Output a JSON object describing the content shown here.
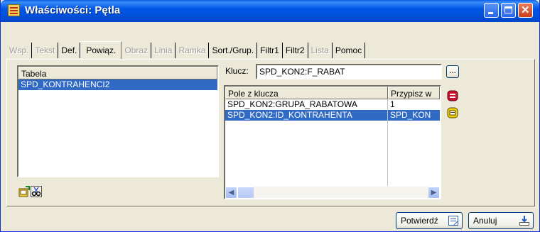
{
  "window": {
    "title": "Właściwości: Pętla"
  },
  "tabs": [
    {
      "label": "Wsp.",
      "enabled": false
    },
    {
      "label": "Tekst",
      "enabled": false
    },
    {
      "label": "Def.",
      "enabled": true
    },
    {
      "label": "Powiąz.",
      "enabled": true,
      "active": true
    },
    {
      "label": "Obraz",
      "enabled": false
    },
    {
      "label": "Linia",
      "enabled": false
    },
    {
      "label": "Ramka",
      "enabled": false
    },
    {
      "label": "Sort./Grup.",
      "enabled": true
    },
    {
      "label": "Filtr1",
      "enabled": true
    },
    {
      "label": "Filtr2",
      "enabled": true
    },
    {
      "label": "Lista",
      "enabled": false
    },
    {
      "label": "Pomoc",
      "enabled": true
    }
  ],
  "tables": {
    "header": "Tabela",
    "items": [
      "SPD_KONTRAHENCI2"
    ],
    "selected_index": 0
  },
  "key": {
    "label": "Klucz:",
    "value": "SPD_KON2:F_RABAT",
    "browse_label": "..."
  },
  "key_fields": {
    "columns": [
      "Pole z klucza",
      "Przypisz w"
    ],
    "rows": [
      [
        "SPD_KON2:GRUPA_RABATOWA",
        "1"
      ],
      [
        "SPD_KON2:ID_KONTRAHENTA",
        "SPD_KON"
      ]
    ],
    "selected_index": 1
  },
  "footer": {
    "confirm_label": "Potwierdź",
    "cancel_label": "Anuluj"
  },
  "colors": {
    "selection": "#316ac5",
    "title_bar": "#0054e3"
  }
}
